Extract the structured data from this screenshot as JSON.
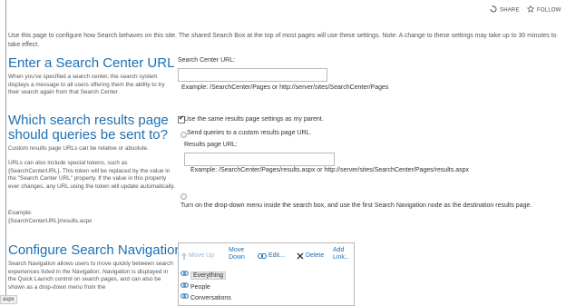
{
  "topbar": {
    "share_label": "SHARE",
    "follow_label": "FOLLOW"
  },
  "intro_text": "Use this page to configure how Search behaves on this site. The shared Search Box at the top of most pages will use these settings. Note: A change to these settings may take up to 30 minutes to take effect.",
  "search_center": {
    "heading": "Enter a Search Center URL",
    "description": "When you've specified a search center, the search system displays a message to all users offering them the ability to try their search again from that Search Center.",
    "field_label": "Search Center URL:",
    "value": "",
    "example": "Example: /SearchCenter/Pages or http://server/sites/SearchCenter/Pages"
  },
  "results_page": {
    "heading_line1": "Which search results page",
    "heading_line2": "should queries be sent to?",
    "desc1": "Custom results page URLs can be relative or absolute.",
    "desc2": "URLs can also include special tokens, such as {SearchCenterURL}. This token will be replaced by the value in the \"Search Center URL\" property. If the value in this property ever changes, any URL using the token will update automatically.",
    "desc3": "Example:",
    "desc4": "{SearchCenterURL}/results.aspx",
    "checkbox_label": "Use the same results page settings as my parent.",
    "radio_custom_label": "Send queries to a custom results page URL.",
    "results_url_label": "Results page URL:",
    "results_url_value": "",
    "results_example": "Example: /SearchCenter/Pages/results.aspx or http://server/sites/SearchCenter/Pages/results.aspx",
    "radio_dropdown_label": "Turn on the drop-down menu inside the search box, and use the first Search Navigation node as the destination results page."
  },
  "search_nav": {
    "heading": "Configure Search Navigation",
    "description": "Search Navigation allows users to move quickly between search experiences listed in the Navigation. Navigation is displayed in the Quick Launch control on search pages, and can also be shown as a drop-down menu from the",
    "toolbar": {
      "move_up": "Move Up",
      "move_down_1": "Move",
      "move_down_2": "Down",
      "edit": "Edit...",
      "delete": "Delete",
      "add_link_1": "Add",
      "add_link_2": "Link..."
    },
    "items": [
      "Everything",
      "People",
      "Conversations"
    ]
  },
  "status_text": "aspx",
  "colors": {
    "heading": "#1d6fb3",
    "link": "#1d6fb3"
  }
}
